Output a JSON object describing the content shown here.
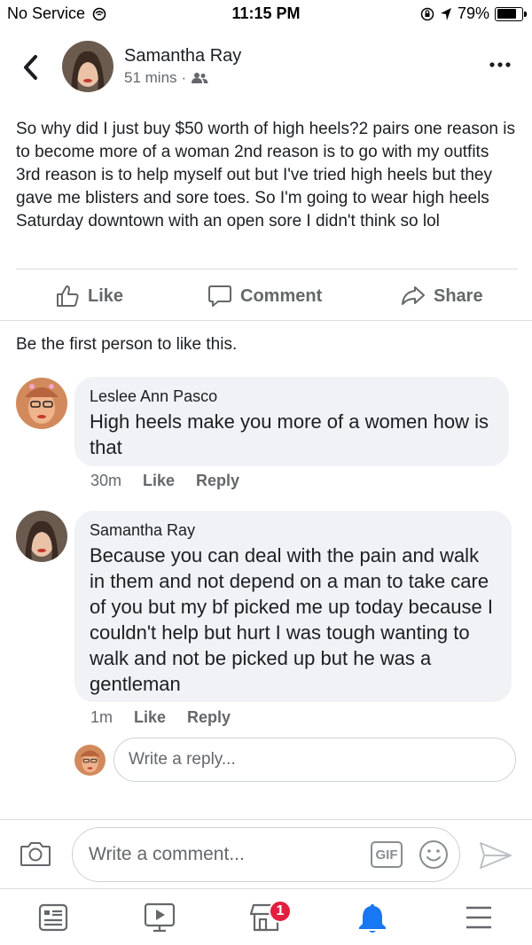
{
  "status_bar": {
    "carrier": "No Service",
    "time": "11:15 PM",
    "battery": "79%",
    "battery_level": 0.79
  },
  "post": {
    "author": "Samantha Ray",
    "time": "51 mins",
    "separator": "·",
    "audience_icon": "friends-icon",
    "body": "So why did I just buy $50 worth of high heels?2 pairs one reason is to become more of a woman 2nd reason is to go with my outfits 3rd reason is to help myself out but I've tried high heels but they gave me blisters and sore toes. So I'm going to wear high heels Saturday downtown with an open sore I didn't think so lol"
  },
  "actions": {
    "like": "Like",
    "comment": "Comment",
    "share": "Share"
  },
  "reactions_summary": "Be the first person to like this.",
  "comments": [
    {
      "name": "Leslee Ann Pasco",
      "text": "High heels make you more of a women how is that",
      "time": "30m",
      "like": "Like",
      "reply": "Reply"
    },
    {
      "name": "Samantha Ray",
      "text": "Because you can deal with the pain and walk in them and not depend on a man to take care of you but my bf picked me up today because I couldn't help but hurt I was tough wanting to walk and not be picked up but he was a gentleman",
      "time": "1m",
      "like": "Like",
      "reply": "Reply"
    }
  ],
  "reply_box": {
    "placeholder": "Write a reply..."
  },
  "composer": {
    "placeholder": "Write a comment...",
    "gif_label": "GIF"
  },
  "tab_bar": {
    "items": [
      "news-feed-icon",
      "watch-icon",
      "marketplace-icon",
      "notifications-icon",
      "menu-icon"
    ],
    "marketplace_badge": "1",
    "active_color": "#1877f2"
  },
  "colors": {
    "secondary_text": "#65676b",
    "bubble_bg": "#f0f2f5",
    "badge": "#e41e3f"
  }
}
